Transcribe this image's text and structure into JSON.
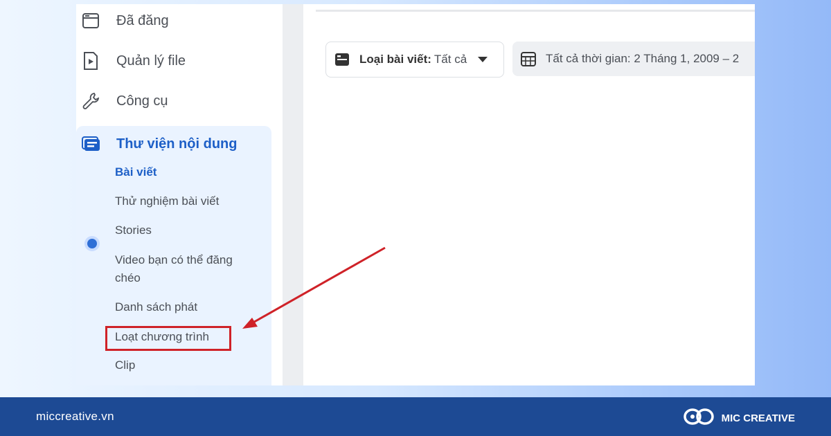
{
  "sidebar": {
    "items": [
      {
        "label": "Đã đăng",
        "icon": "posted-icon"
      },
      {
        "label": "Quản lý file",
        "icon": "file-manager-icon"
      },
      {
        "label": "Công cụ",
        "icon": "wrench-icon"
      }
    ],
    "library": {
      "title": "Thư viện nội dung",
      "icon": "content-library-icon",
      "subitems": [
        "Bài viết",
        "Thử nghiệm bài viết",
        "Stories",
        "Video bạn có thể đăng",
        "chéo",
        "Danh sách phát",
        "Loạt chương trình",
        "Clip"
      ]
    }
  },
  "filters": {
    "post_type_label": "Loại bài viết:",
    "post_type_value": "Tất cả",
    "time_label": "Tất cả thời gian: 2 Tháng 1, 2009 – 2"
  },
  "footer": {
    "site": "miccreative.vn",
    "brand": "MIC CREATIVE"
  },
  "colors": {
    "accent": "#1d5fc7",
    "highlight": "#cf2228",
    "footer": "#1d4a94"
  }
}
